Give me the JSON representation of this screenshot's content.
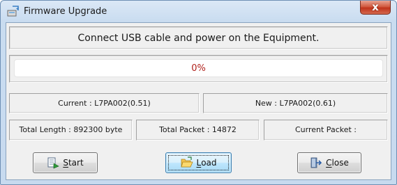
{
  "window": {
    "title": "Firmware Upgrade",
    "close_glyph": "x"
  },
  "message": "Connect USB cable and power on the Equipment.",
  "progress": {
    "percent": 0,
    "label": "0%"
  },
  "versions": {
    "current": "Current : L7PA002(0.51)",
    "new": "New : L7PA002(0.61)"
  },
  "stats": {
    "total_length": "Total Length : 892300 byte",
    "total_packet": "Total Packet : 14872",
    "current_packet": "Current Packet :"
  },
  "buttons": {
    "start": {
      "mnemonic": "S",
      "rest": "tart",
      "icon": "start-icon"
    },
    "load": {
      "mnemonic": "L",
      "rest": "oad",
      "icon": "folder-open-icon"
    },
    "close": {
      "mnemonic": "C",
      "rest": "lose",
      "icon": "exit-door-icon"
    }
  },
  "colors": {
    "progress_text": "#b0211b",
    "focused_button_border": "#3c7fb1"
  }
}
